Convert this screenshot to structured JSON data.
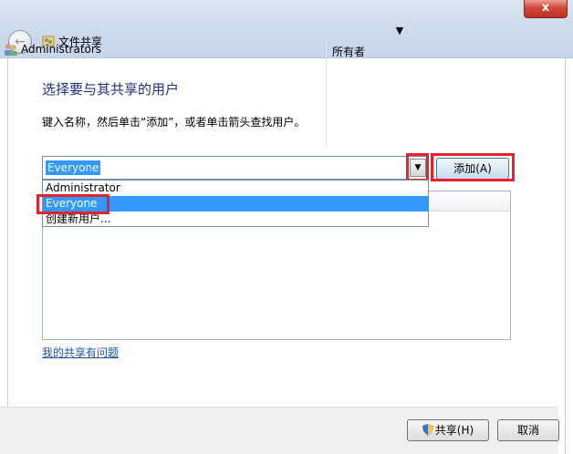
{
  "window": {
    "title": "文件共享",
    "close_label": "x"
  },
  "main": {
    "heading": "选择要与其共享的用户",
    "instruction": "键入名称，然后单击“添加”，或者单击箭头查找用户。",
    "combo_value": "Everyone",
    "add_button_label": "添加(A)"
  },
  "dropdown": {
    "items": [
      {
        "label": "Administrator"
      },
      {
        "label": "Everyone"
      },
      {
        "label": "创建新用户..."
      }
    ]
  },
  "table": {
    "rows": [
      {
        "name": "Administrators",
        "permission": "所有者"
      }
    ]
  },
  "help_link": "我的共享有问题",
  "footer": {
    "share_label": "共享(H)",
    "cancel_label": "取消"
  },
  "colors": {
    "highlight_border": "#e5232d",
    "selection": "#3399ff",
    "heading": "#1e3287",
    "link": "#1a56b0"
  }
}
